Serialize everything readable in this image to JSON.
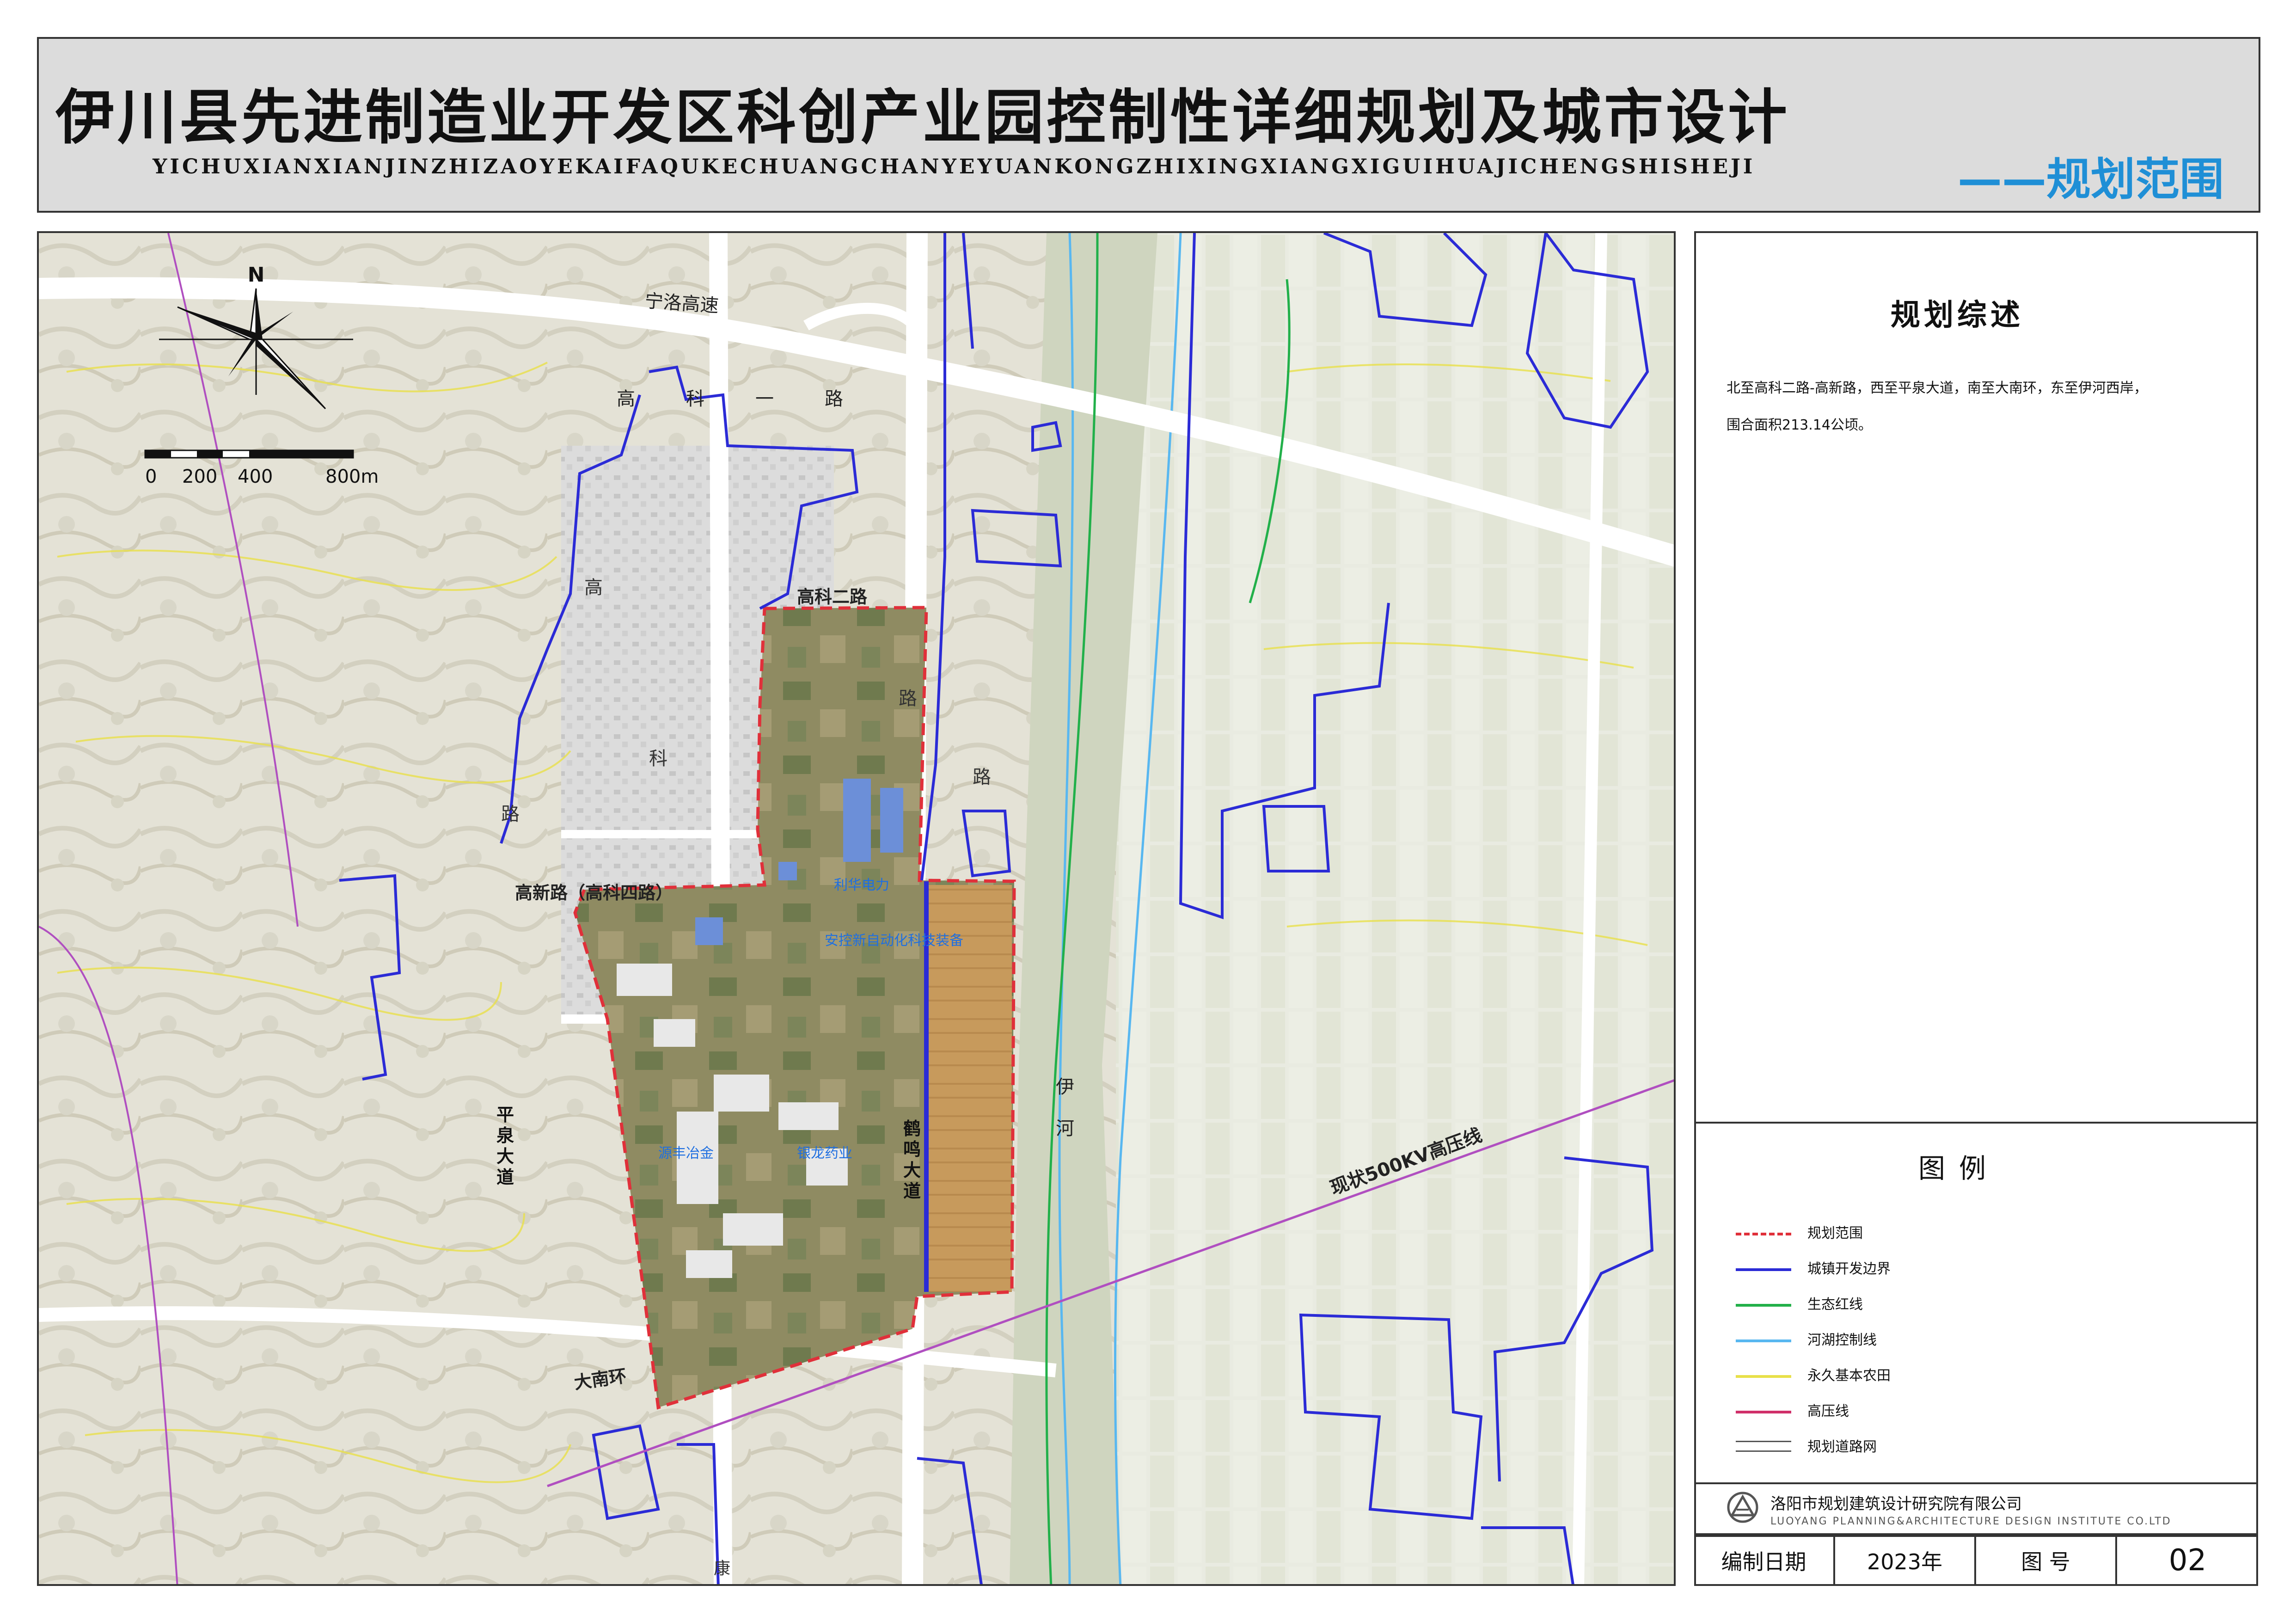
{
  "header": {
    "title": "伊川县先进制造业开发区科创产业园控制性详细规划及城市设计",
    "subtitle": "YICHUXIANXIANJINZHIZAOYEKAIFAQUKECHUANGCHANYEYUANKONGZHIXINGXIANGXIGUIHUAJICHENGSHISHEJI",
    "sheet_name": "——规划范围"
  },
  "map": {
    "north_label": "N",
    "scale_labels": [
      "0",
      "200",
      "400",
      "800m"
    ],
    "road_labels": {
      "ningluo": "宁洛高速",
      "gaoke_yi": "高科一路",
      "gaoke_er": "高科二路",
      "gaoxin": "高新路（高科四路）",
      "pingquan": "平泉大道",
      "henming": "鹤鸣大道",
      "danan": "大南环",
      "kang": "康",
      "gaoke_xi_1": "高",
      "gaoke_xi_2": "科",
      "road_char": "路"
    },
    "area_labels": {
      "lihua": "利华电力",
      "anchi": "安控新自动化科技装备",
      "yuanfeng": "源丰冶金",
      "longfeng": "银龙药业"
    },
    "river_label": "伊\n河",
    "river_chars": [
      "伊",
      "河"
    ],
    "powerline_label": "现状500KV高压线",
    "colors": {
      "planning_boundary": "#e0303a",
      "urban_boundary": "#2b2bd6",
      "eco_redline": "#22b04a",
      "river_control": "#58b7f0",
      "farmland": "#e8e04a",
      "powerline": "#b04fc0",
      "roads": "#ffffff"
    }
  },
  "overview": {
    "title": "规划综述",
    "line1": "北至高科二路-高新路，西至平泉大道，南至大南环，东至伊河西岸，",
    "line2": "围合面积213.14公顷。"
  },
  "legend": {
    "title": "图例",
    "items": [
      {
        "label": "规划范围",
        "color": "#e0303a",
        "style": "dashed"
      },
      {
        "label": "城镇开发边界",
        "color": "#2b2bd6",
        "style": "solid"
      },
      {
        "label": "生态红线",
        "color": "#22b04a",
        "style": "solid"
      },
      {
        "label": "河湖控制线",
        "color": "#58b7f0",
        "style": "solid"
      },
      {
        "label": "永久基本农田",
        "color": "#e8e04a",
        "style": "solid"
      },
      {
        "label": "高压线",
        "color": "#d0306a",
        "style": "solid"
      },
      {
        "label": "规划道路网",
        "color": "#555555",
        "style": "road"
      }
    ]
  },
  "org": {
    "name": "洛阳市规划建筑设计研究院有限公司",
    "name_en": "LUOYANG PLANNING&ARCHITECTURE DESIGN INSTITUTE CO.LTD"
  },
  "footer": {
    "date_label": "编制日期",
    "date_value": "2023年",
    "number_label": "图 号",
    "number_value": "02"
  }
}
